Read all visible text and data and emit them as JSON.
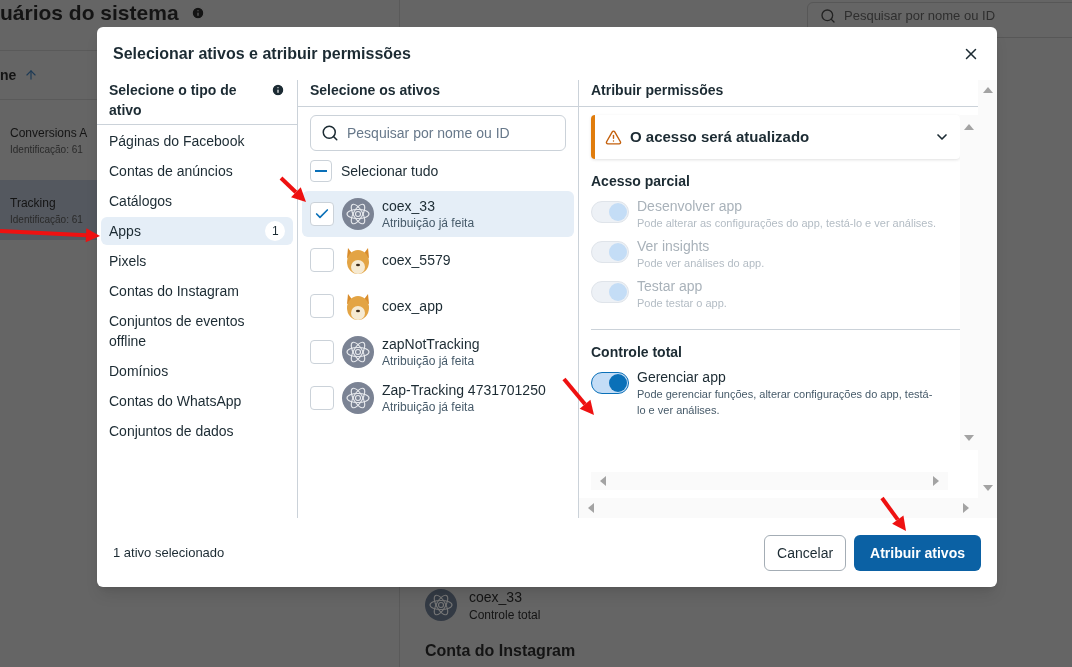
{
  "background": {
    "page_title": "uários do sistema",
    "column_header": "ne",
    "rows": [
      {
        "name": "Conversions A",
        "id": "Identificação: 61",
        "selected": false
      },
      {
        "name": "Tracking",
        "id": "Identificação: 61",
        "selected": true
      }
    ],
    "search": {
      "placeholder": "Pesquisar por nome ou ID"
    },
    "detail": {
      "app_name": "coex_33",
      "app_role": "Controle total",
      "section_title": "Conta do Instagram"
    }
  },
  "modal": {
    "title": "Selecionar ativos e atribuir permissões",
    "asset_types": {
      "title": "Selecione o tipo de ativo",
      "items": [
        {
          "label": "Páginas do Facebook",
          "selected": false
        },
        {
          "label": "Contas de anúncios",
          "selected": false
        },
        {
          "label": "Catálogos",
          "selected": false
        },
        {
          "label": "Apps",
          "count": "1",
          "selected": true
        },
        {
          "label": "Pixels",
          "selected": false
        },
        {
          "label": "Contas do Instagram",
          "selected": false
        },
        {
          "label": "Conjuntos de eventos offline",
          "selected": false
        },
        {
          "label": "Domínios",
          "selected": false
        },
        {
          "label": "Contas do WhatsApp",
          "selected": false
        },
        {
          "label": "Conjuntos de dados",
          "selected": false
        }
      ]
    },
    "assets": {
      "title": "Selecione os ativos",
      "search_placeholder": "Pesquisar por nome ou ID",
      "select_all": {
        "label": "Selecionar tudo",
        "indeterminate": true
      },
      "items": [
        {
          "name": "coex_33",
          "subtitle": "Atribuição já feita",
          "kind": "atom",
          "checked": true
        },
        {
          "name": "coex_5579",
          "checked": false
        },
        {
          "name": "coex_app",
          "checked": false
        },
        {
          "name": "zapNotTracking",
          "subtitle": "Atribuição já feita",
          "kind": "atom",
          "checked": false
        },
        {
          "name": "Zap-Tracking 4731701250",
          "subtitle": "Atribuição já feita",
          "kind": "atom",
          "checked": false
        }
      ]
    },
    "permissions": {
      "title": "Atribuir permissões",
      "notice": {
        "text": "O acesso será atualizado",
        "expanded": false
      },
      "groups": [
        {
          "title": "Acesso parcial",
          "items": [
            {
              "label": "Desenvolver app",
              "description": "Pode alterar as configurações do app, testá-lo e ver análises.",
              "on": true,
              "disabled": true
            },
            {
              "label": "Ver insights",
              "description": "Pode ver análises do app.",
              "on": true,
              "disabled": true
            },
            {
              "label": "Testar app",
              "description": "Pode testar o app.",
              "on": true,
              "disabled": true
            }
          ]
        },
        {
          "title": "Controle total",
          "items": [
            {
              "label": "Gerenciar app",
              "description": "Pode gerenciar funções, alterar configurações do app, testá-lo e ver análises.",
              "on": true,
              "disabled": false
            }
          ]
        }
      ]
    },
    "footer": {
      "summary": "1 ativo selecionado",
      "cancel": "Cancelar",
      "submit": "Atribuir ativos"
    }
  }
}
